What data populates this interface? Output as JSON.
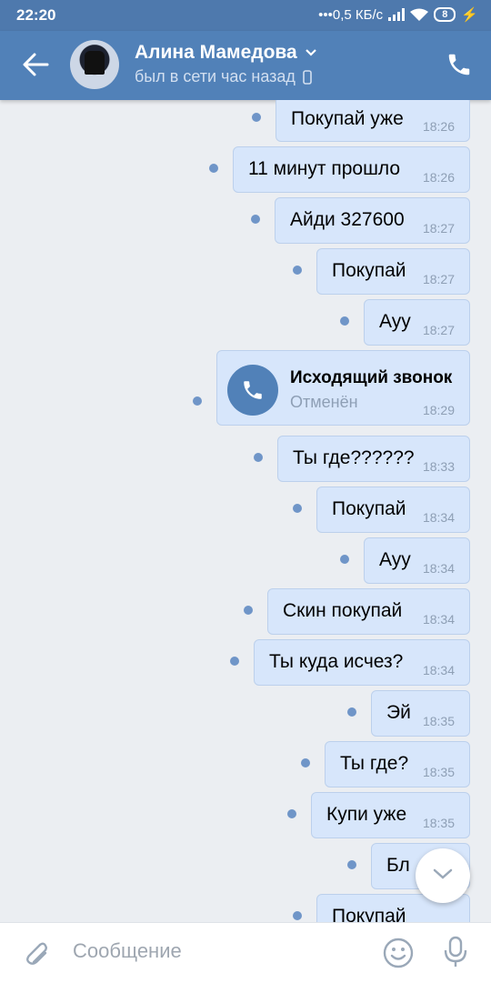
{
  "statusbar": {
    "time": "22:20",
    "network": "0,5 КБ/с",
    "battery": "8"
  },
  "header": {
    "name": "Алина Мамедова",
    "last_seen": "был в сети час назад",
    "icons": [
      "back-arrow-icon",
      "chevron-down-icon",
      "mobile-icon",
      "phone-icon"
    ]
  },
  "messages": [
    {
      "text": "Покупай уже",
      "time": "18:26"
    },
    {
      "text": "11 минут прошло",
      "time": "18:26"
    },
    {
      "text": "Айди 327600",
      "time": "18:27"
    },
    {
      "text": "Покупай",
      "time": "18:27"
    },
    {
      "text": "Ауу",
      "time": "18:27"
    },
    {
      "text": "Ты где??????",
      "time": "18:33"
    },
    {
      "text": "Покупай",
      "time": "18:34"
    },
    {
      "text": "Ауу",
      "time": "18:34"
    },
    {
      "text": "Скин покупай",
      "time": "18:34"
    },
    {
      "text": "Ты куда исчез?",
      "time": "18:34"
    },
    {
      "text": "Эй",
      "time": "18:35"
    },
    {
      "text": "Ты где?",
      "time": "18:35"
    },
    {
      "text": "Купи уже",
      "time": "18:35"
    },
    {
      "text": "Бл",
      "time": ""
    },
    {
      "text": "Покупай",
      "time": ""
    }
  ],
  "call": {
    "title": "Исходящий звонок",
    "subtitle": "Отменён",
    "time": "18:29"
  },
  "composer": {
    "placeholder": "Сообщение"
  },
  "colors": {
    "header": "#5181b8",
    "bubble": "#d7e6fb",
    "unread_dot": "#6f95c8"
  }
}
